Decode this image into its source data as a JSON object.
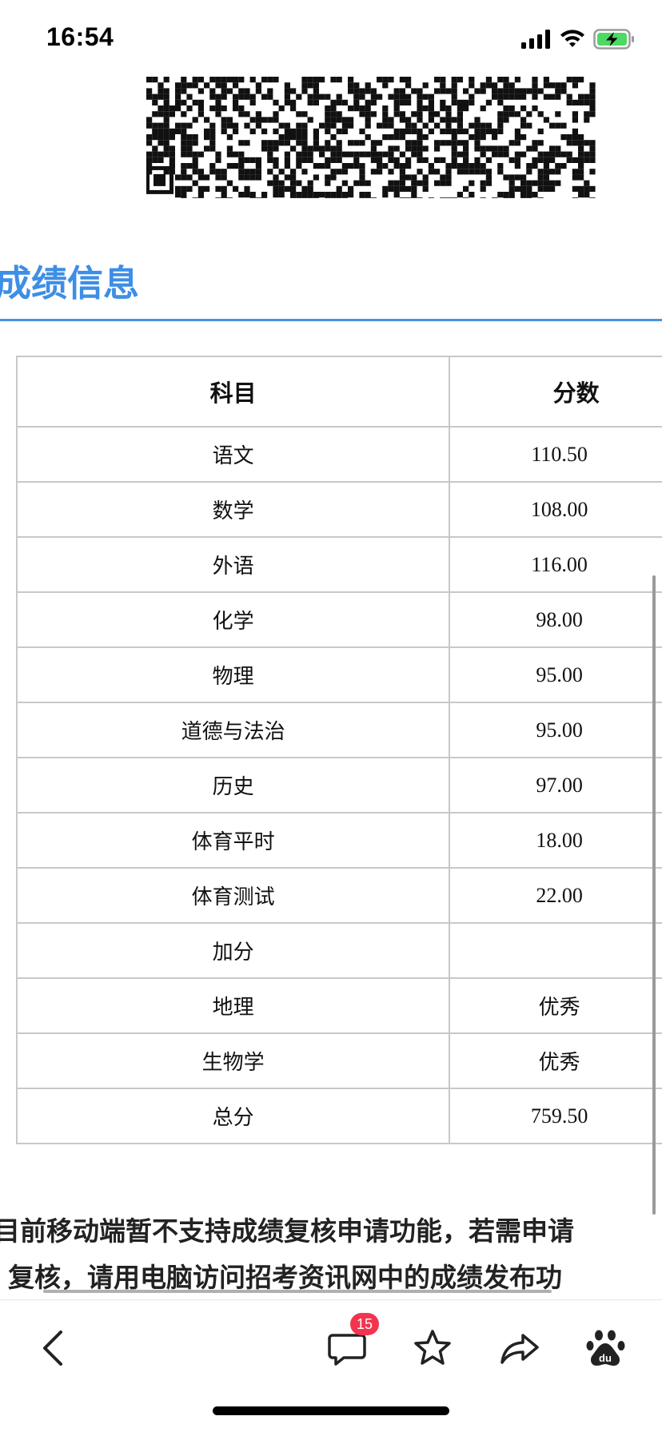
{
  "status_bar": {
    "time": "16:54"
  },
  "section": {
    "title": "成绩信息"
  },
  "table": {
    "headers": [
      "科目",
      "分数"
    ],
    "rows": [
      {
        "subject": "语文",
        "score": "110.50"
      },
      {
        "subject": "数学",
        "score": "108.00"
      },
      {
        "subject": "外语",
        "score": "116.00"
      },
      {
        "subject": "化学",
        "score": "98.00"
      },
      {
        "subject": "物理",
        "score": "95.00"
      },
      {
        "subject": "道德与法治",
        "score": "95.00"
      },
      {
        "subject": "历史",
        "score": "97.00"
      },
      {
        "subject": "体育平时",
        "score": "18.00"
      },
      {
        "subject": "体育测试",
        "score": "22.00"
      },
      {
        "subject": "加分",
        "score": ""
      },
      {
        "subject": "地理",
        "score": "优秀"
      },
      {
        "subject": "生物学",
        "score": "优秀"
      },
      {
        "subject": "总分",
        "score": "759.50"
      }
    ]
  },
  "notice": {
    "line1": "目前移动端暂不支持成绩复核申请功能，若需申请",
    "line2": "复核，请用电脑访问招考资讯网中的成绩发布功"
  },
  "toolbar": {
    "comment_count": "15"
  },
  "colors": {
    "accent": "#3d8ee6",
    "badge": "#f2344f",
    "battery": "#4cd964"
  }
}
